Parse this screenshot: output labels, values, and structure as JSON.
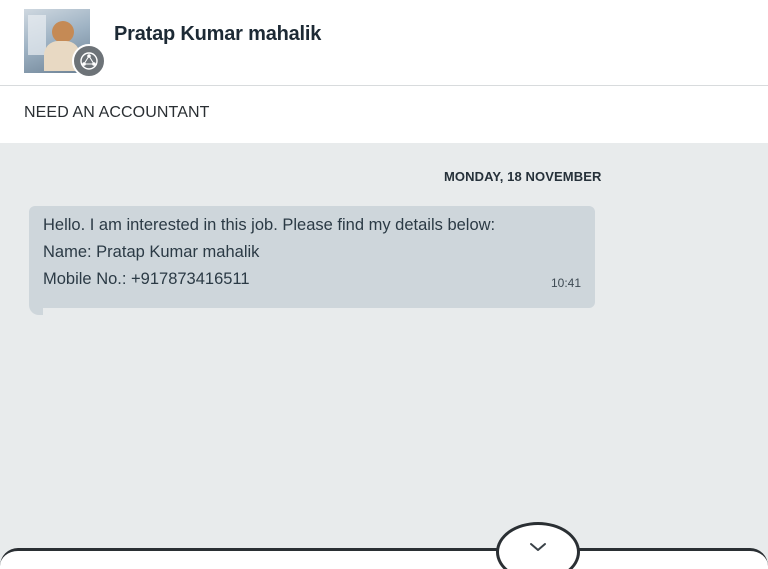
{
  "header": {
    "contact_name": "Pratap Kumar mahalik",
    "avatar_icon": "profile-photo",
    "badge_icon": "network-icon"
  },
  "subject": {
    "title": "NEED AN ACCOUNTANT"
  },
  "chat": {
    "date_separator": "MONDAY, 18 NOVEMBER",
    "messages": [
      {
        "lines": [
          "Hello. I am interested in this job. Please find my details below:",
          "Name: Pratap Kumar mahalik",
          "Mobile No.: +917873416511"
        ],
        "time": "10:41"
      }
    ]
  },
  "controls": {
    "scroll_down_icon": "chevron-down-icon"
  },
  "colors": {
    "chat_background": "#e8ebec",
    "bubble_background": "#ced6db",
    "header_text": "#1d2a35"
  }
}
